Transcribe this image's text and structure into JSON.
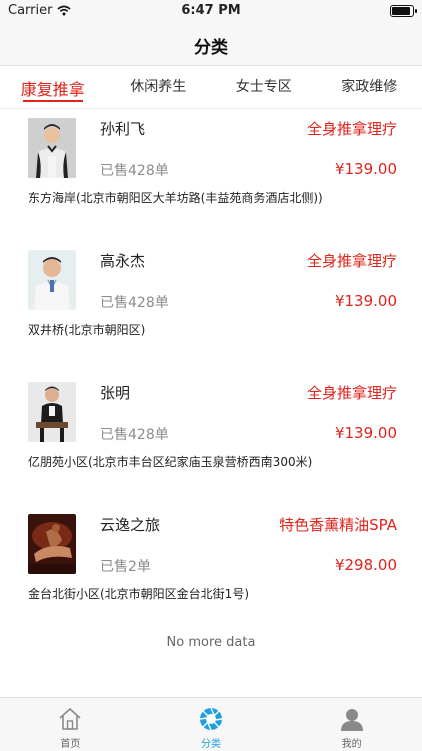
{
  "status_bar": {
    "carrier": "Carrier",
    "time": "6:47 PM"
  },
  "nav": {
    "title": "分类"
  },
  "tabs": [
    {
      "label": "康复推拿",
      "active": true
    },
    {
      "label": "休闲养生",
      "active": false
    },
    {
      "label": "女士专区",
      "active": false
    },
    {
      "label": "家政维修",
      "active": false
    }
  ],
  "items": [
    {
      "name": "孙利飞",
      "service": "全身推拿理疗",
      "sold": "已售428单",
      "price": "¥139.00",
      "address": "东方海岸(北京市朝阳区大羊坊路(丰益苑商务酒店北侧))",
      "photo": "man-in-suit-photo"
    },
    {
      "name": "高永杰",
      "service": "全身推拿理疗",
      "sold": "已售428单",
      "price": "¥139.00",
      "address": "双井桥(北京市朝阳区)",
      "photo": "man-in-white-coat-photo"
    },
    {
      "name": "张明",
      "service": "全身推拿理疗",
      "sold": "已售428单",
      "price": "¥139.00",
      "address": "亿朋苑小区(北京市丰台区纪家庙玉泉营桥西南300米)",
      "photo": "man-seated-photo"
    },
    {
      "name": "云逸之旅",
      "service": "特色香薰精油SPA",
      "sold": "已售2单",
      "price": "¥298.00",
      "address": "金台北街小区(北京市朝阳区金台北街1号)",
      "photo": "spa-massage-photo"
    }
  ],
  "footer": {
    "no_more": "No more data"
  },
  "tab_bar": [
    {
      "label": "首页",
      "icon": "home-icon",
      "active": false
    },
    {
      "label": "分类",
      "icon": "aperture-icon",
      "active": true
    },
    {
      "label": "我的",
      "icon": "profile-icon",
      "active": false
    }
  ],
  "colors": {
    "accent": "#e0241b",
    "tab_active": "#1f9fe0"
  }
}
